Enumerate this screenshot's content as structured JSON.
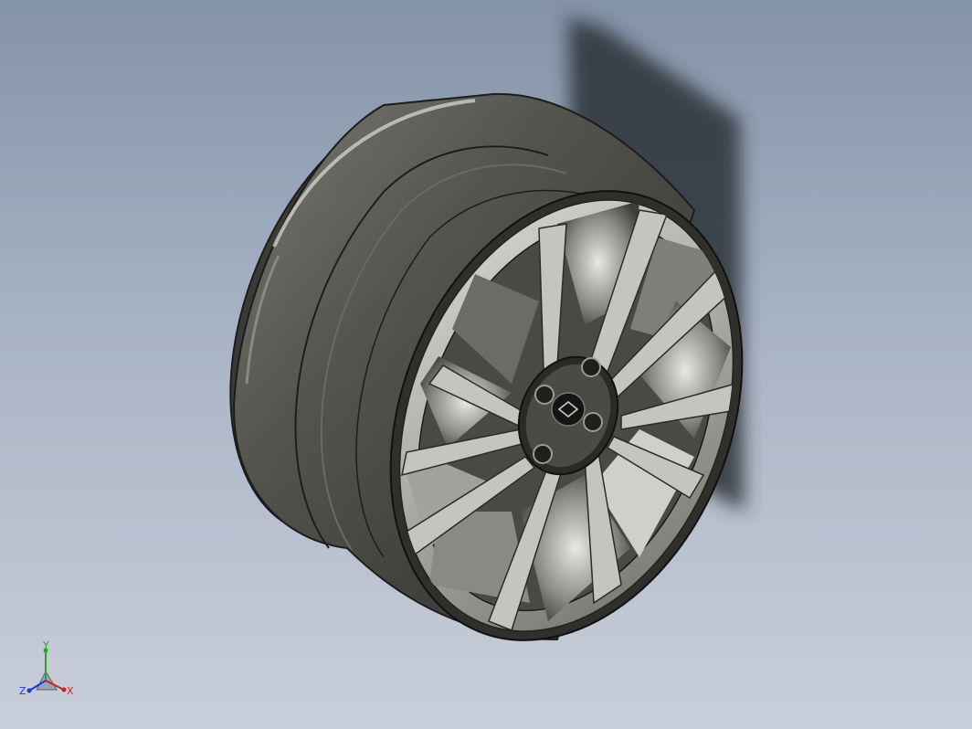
{
  "viewport": {
    "background_top": "#8493a9",
    "background_bottom": "#c9cfda",
    "model": "alloy-wheel-rim"
  },
  "triad": {
    "x_label": "X",
    "y_label": "Y",
    "z_label": "Z",
    "x_color": "#d21f1f",
    "y_color": "#2aa52a",
    "z_color": "#1f3ad2"
  },
  "colors": {
    "rim_dark": "#3a3a36",
    "rim_mid": "#5a5a54",
    "rim_light": "#8a8a82",
    "face_silver": "#b9b9b6",
    "shadow": "#2b3038"
  }
}
